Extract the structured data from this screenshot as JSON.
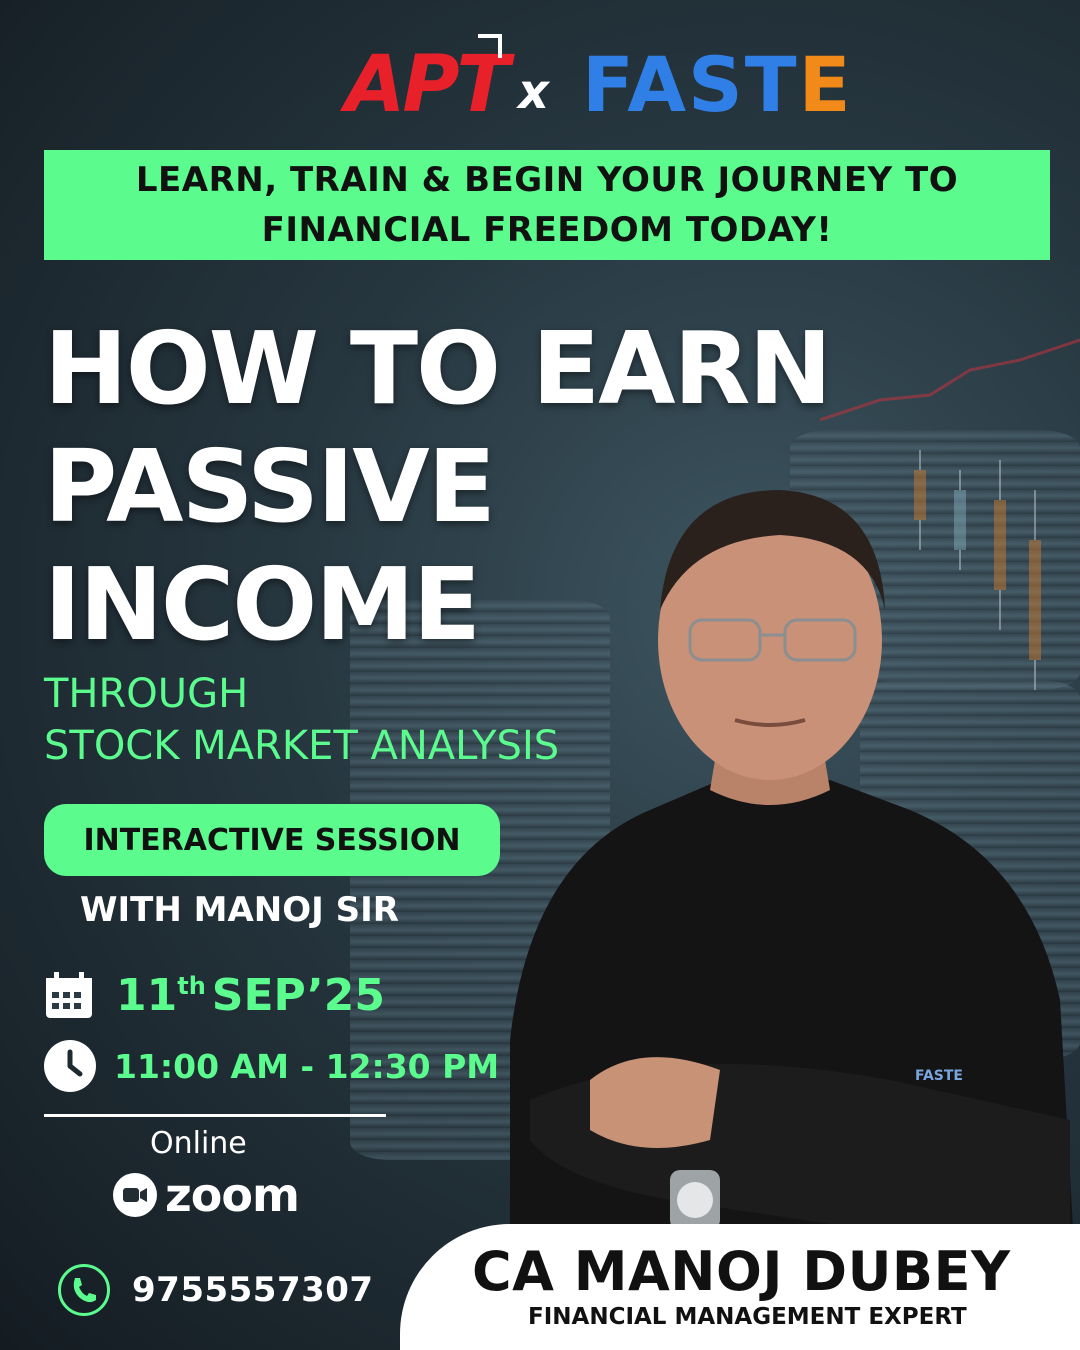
{
  "logo": {
    "left": "APT",
    "separator": "x",
    "right": "FAST",
    "right_accent": "E"
  },
  "banner": {
    "line1": "LEARN, TRAIN & BEGIN YOUR JOURNEY TO",
    "line2": "FINANCIAL FREEDOM TODAY!"
  },
  "headline": {
    "line1": "HOW TO EARN",
    "line2": "PASSIVE",
    "line3": "INCOME"
  },
  "subheadline": {
    "line1": "THROUGH",
    "line2": "STOCK MARKET ANALYSIS"
  },
  "session": {
    "badge": "INTERACTIVE SESSION",
    "with": "WITH MANOJ SIR"
  },
  "event": {
    "day": "11",
    "day_suffix": "th",
    "month_year": "SEP’25",
    "time": "11:00 AM - 12:30 PM",
    "mode": "Online",
    "platform": "zoom"
  },
  "contact": {
    "phone": "9755557307"
  },
  "speaker": {
    "name": "CA MANOJ DUBEY",
    "title": "FINANCIAL MANAGEMENT EXPERT",
    "shirt_logo": "FASTE"
  },
  "icons": {
    "date": "calendar-icon",
    "time": "clock-icon",
    "platform": "zoom-camera-icon",
    "phone": "phone-icon"
  },
  "colors": {
    "accent_green": "#5cfb8e",
    "apt_red": "#e8202a",
    "faste_blue": "#2f7fe6",
    "faste_orange": "#f28a1a"
  }
}
